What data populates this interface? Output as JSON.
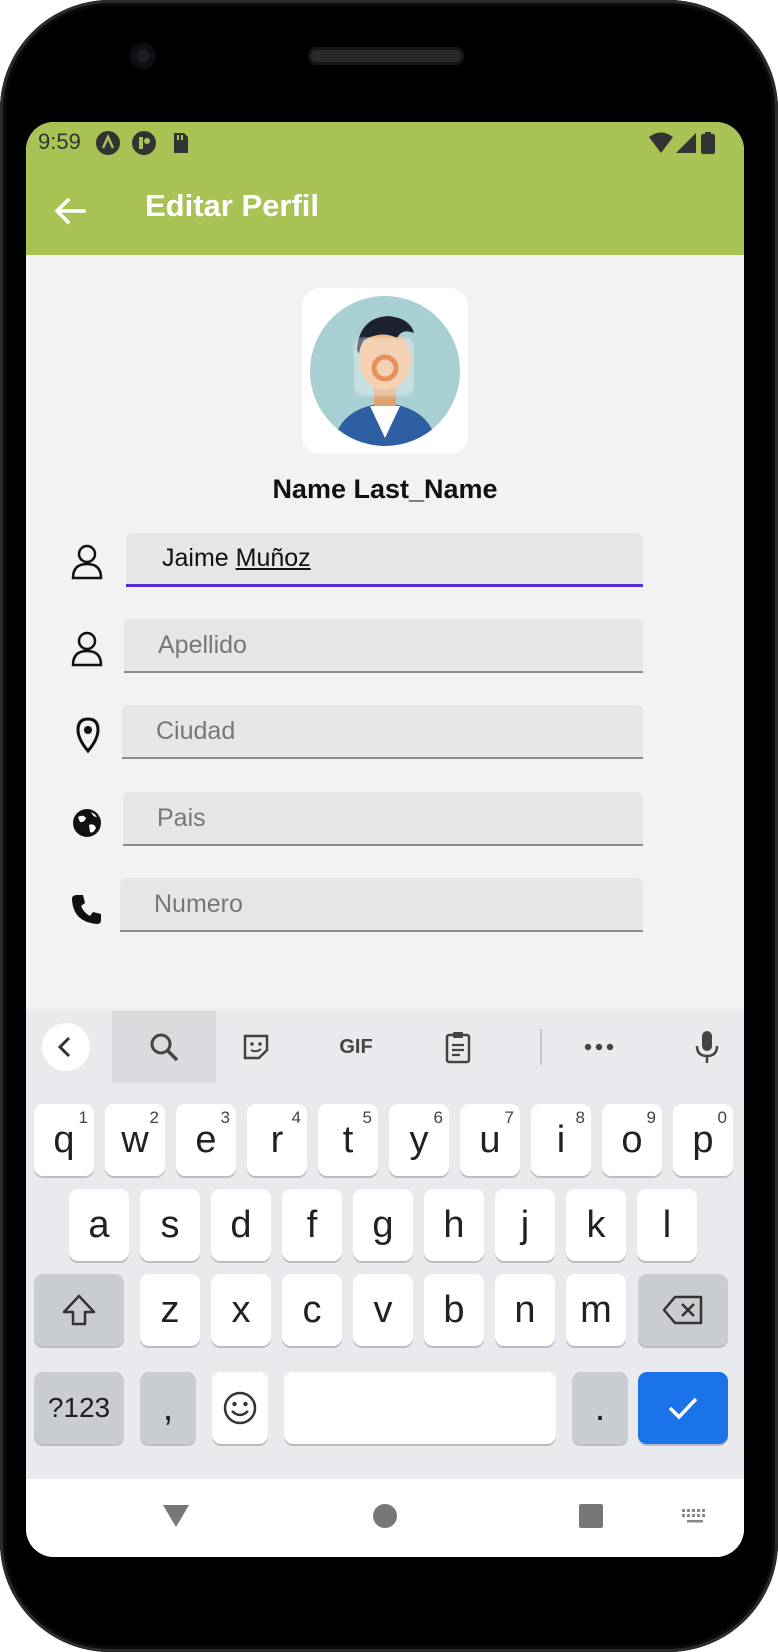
{
  "statusbar": {
    "time": "9:59"
  },
  "appbar": {
    "title": "Editar Perfil"
  },
  "profile": {
    "name": "Name Last_Name"
  },
  "form": {
    "first_name": {
      "value_prefix": "Jaime ",
      "value_underlined": "Muñoz"
    },
    "last_name": {
      "placeholder": "Apellido"
    },
    "city": {
      "placeholder": "Ciudad"
    },
    "country": {
      "placeholder": "Pais"
    },
    "phone": {
      "placeholder": "Numero"
    }
  },
  "keyboard": {
    "toolbar": {
      "gif_label": "GIF"
    },
    "row1": [
      {
        "k": "q",
        "h": "1"
      },
      {
        "k": "w",
        "h": "2"
      },
      {
        "k": "e",
        "h": "3"
      },
      {
        "k": "r",
        "h": "4"
      },
      {
        "k": "t",
        "h": "5"
      },
      {
        "k": "y",
        "h": "6"
      },
      {
        "k": "u",
        "h": "7"
      },
      {
        "k": "i",
        "h": "8"
      },
      {
        "k": "o",
        "h": "9"
      },
      {
        "k": "p",
        "h": "0"
      }
    ],
    "row2": [
      "a",
      "s",
      "d",
      "f",
      "g",
      "h",
      "j",
      "k",
      "l"
    ],
    "row3": [
      "z",
      "x",
      "c",
      "v",
      "b",
      "n",
      "m"
    ],
    "symbols_label": "?123",
    "comma_label": ",",
    "period_label": "."
  },
  "colors": {
    "accent": "#a8c354",
    "focus": "#5b2fd8",
    "enter_key": "#1a73e8"
  },
  "icons": [
    "back-arrow-icon",
    "person-icon",
    "location-pin-icon",
    "globe-icon",
    "phone-icon",
    "search-icon",
    "sticker-icon",
    "clipboard-icon",
    "more-icon",
    "mic-icon",
    "shift-icon",
    "backspace-icon",
    "emoji-icon",
    "check-icon"
  ]
}
